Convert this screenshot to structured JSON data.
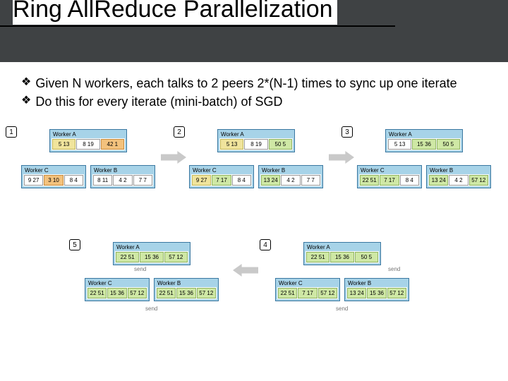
{
  "slide": {
    "title": "Ring AllReduce Parallelization",
    "bullets": [
      "Given N workers, each talks to 2 peers 2*(N-1) times to sync up one iterate",
      "Do this for every iterate (mini-batch) of SGD"
    ]
  },
  "workers": {
    "labelA": "Worker A",
    "labelB": "Worker B",
    "labelC": "Worker C"
  },
  "send": "send",
  "stages": [
    {
      "step": 1,
      "A": [
        "5 13",
        "8 19",
        "42 1"
      ],
      "C": [
        "9 27",
        "3 10",
        "8 4"
      ],
      "B": [
        "8 11",
        "4 2",
        "7 7"
      ]
    },
    {
      "step": 2,
      "A": [
        "5 13",
        "8 19",
        "50 5"
      ],
      "C": [
        "9 27",
        "7 17",
        "8 4"
      ],
      "B": [
        "13 24",
        "4 2",
        "7 7"
      ]
    },
    {
      "step": 3,
      "A": [
        "5 13",
        "15 36",
        "50 5"
      ],
      "C": [
        "22 51",
        "7 17",
        "8 4"
      ],
      "B": [
        "13 24",
        "4 2",
        "57 12"
      ]
    },
    {
      "step": 4,
      "A": [
        "22 51",
        "15 36",
        "50 5"
      ],
      "C": [
        "22 51",
        "7 17",
        "57 12"
      ],
      "B": [
        "13 24",
        "15 36",
        "57 12"
      ]
    },
    {
      "step": 5,
      "A": [
        "22 51",
        "15 36",
        "57 12"
      ],
      "C": [
        "22 51",
        "15 36",
        "57 12"
      ],
      "B": [
        "22 51",
        "15 36",
        "57 12"
      ]
    }
  ]
}
